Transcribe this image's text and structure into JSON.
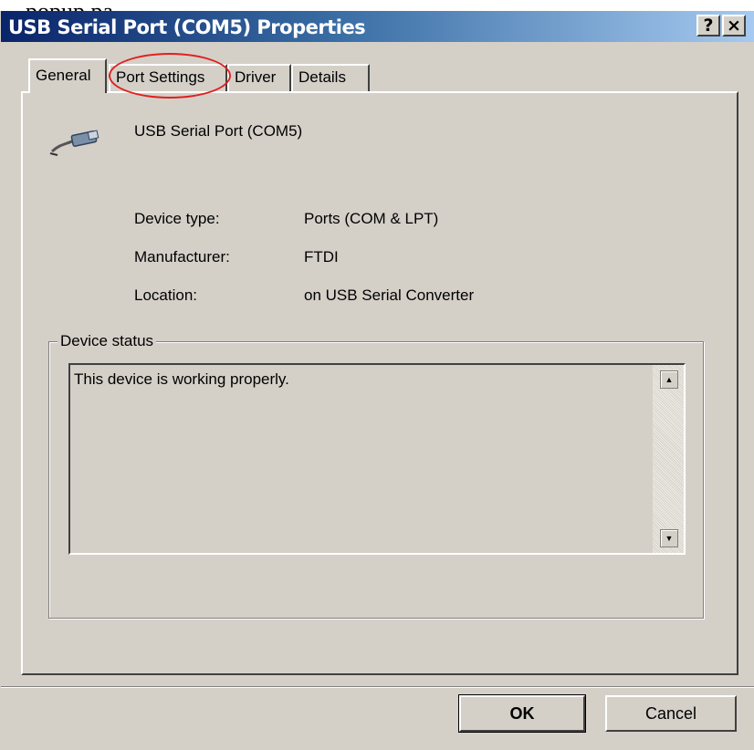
{
  "caption": "... popup pa",
  "window": {
    "title": "USB Serial Port (COM5) Properties",
    "help_label": "?",
    "close_label": "×"
  },
  "tabs": [
    {
      "label": "General",
      "active": true
    },
    {
      "label": "Port Settings",
      "active": false
    },
    {
      "label": "Driver",
      "active": false
    },
    {
      "label": "Details",
      "active": false
    }
  ],
  "device": {
    "icon": "usb-cable-icon",
    "name": "USB Serial Port (COM5)"
  },
  "properties": [
    {
      "label": "Device type:",
      "value": "Ports (COM & LPT)"
    },
    {
      "label": "Manufacturer:",
      "value": "FTDI"
    },
    {
      "label": "Location:",
      "value": "on USB Serial Converter"
    }
  ],
  "status": {
    "legend": "Device status",
    "text": "This device is working properly.",
    "scroll_up": "▲",
    "scroll_down": "▼"
  },
  "buttons": {
    "ok": "OK",
    "cancel": "Cancel"
  },
  "colors": {
    "titlebar_start": "#0a246a",
    "titlebar_end": "#a6caf0",
    "dialog_face": "#d4d0c8",
    "highlight_circle": "#e02020"
  }
}
